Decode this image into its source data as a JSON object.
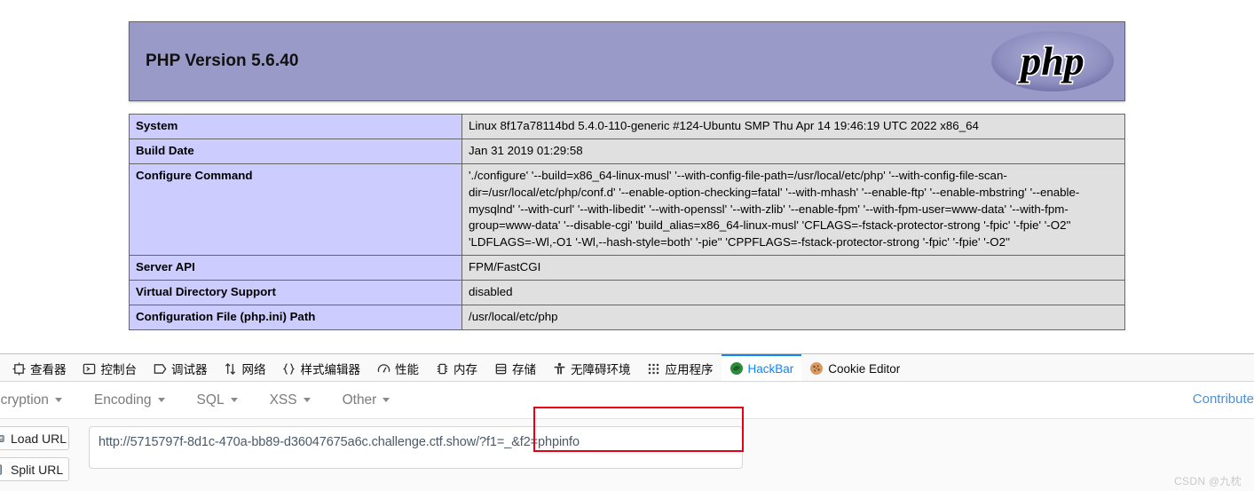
{
  "phpinfo": {
    "version_title": "PHP Version 5.6.40",
    "logo_text": "php",
    "rows": [
      {
        "label": "System",
        "value": "Linux 8f17a78114bd 5.4.0-110-generic #124-Ubuntu SMP Thu Apr 14 19:46:19 UTC 2022 x86_64"
      },
      {
        "label": "Build Date",
        "value": "Jan 31 2019 01:29:58"
      },
      {
        "label": "Configure Command",
        "value": "'./configure'  '--build=x86_64-linux-musl' '--with-config-file-path=/usr/local/etc/php' '--with-config-file-scan-dir=/usr/local/etc/php/conf.d' '--enable-option-checking=fatal' '--with-mhash' '--enable-ftp' '--enable-mbstring' '--enable-mysqlnd' '--with-curl' '--with-libedit' '--with-openssl' '--with-zlib' '--enable-fpm' '--with-fpm-user=www-data' '--with-fpm-group=www-data' '--disable-cgi' 'build_alias=x86_64-linux-musl' 'CFLAGS=-fstack-protector-strong '-fpic' '-fpie' '-O2'' 'LDFLAGS=-Wl,-O1 '-Wl,--hash-style=both' '-pie'' 'CPPFLAGS=-fstack-protector-strong '-fpic' '-fpie' '-O2''"
      },
      {
        "label": "Server API",
        "value": "FPM/FastCGI"
      },
      {
        "label": "Virtual Directory Support",
        "value": "disabled"
      },
      {
        "label": "Configuration File (php.ini) Path",
        "value": "/usr/local/etc/php"
      }
    ]
  },
  "devtools": {
    "tabs": [
      {
        "label": "查看器",
        "icon": "inspector-icon",
        "active": false
      },
      {
        "label": "控制台",
        "icon": "console-icon",
        "active": false
      },
      {
        "label": "调试器",
        "icon": "debugger-icon",
        "active": false
      },
      {
        "label": "网络",
        "icon": "network-icon",
        "active": false
      },
      {
        "label": "样式编辑器",
        "icon": "style-editor-icon",
        "active": false
      },
      {
        "label": "性能",
        "icon": "performance-icon",
        "active": false
      },
      {
        "label": "内存",
        "icon": "memory-icon",
        "active": false
      },
      {
        "label": "存储",
        "icon": "storage-icon",
        "active": false
      },
      {
        "label": "无障碍环境",
        "icon": "accessibility-icon",
        "active": false
      },
      {
        "label": "应用程序",
        "icon": "application-icon",
        "active": false
      },
      {
        "label": "HackBar",
        "icon": "hackbar-icon",
        "active": true
      },
      {
        "label": "Cookie Editor",
        "icon": "cookie-icon",
        "active": false
      }
    ]
  },
  "hackbar": {
    "menus": [
      {
        "label": "ncryption"
      },
      {
        "label": "Encoding"
      },
      {
        "label": "SQL"
      },
      {
        "label": "XSS"
      },
      {
        "label": "Other"
      }
    ],
    "contribute_label": "Contribute",
    "buttons": [
      {
        "label": "Load URL",
        "icon": "load-url-icon"
      },
      {
        "label": "Split URL",
        "icon": "split-url-icon"
      }
    ],
    "url_value": "http://5715797f-8d1c-470a-bb89-d36047675a6c.challenge.ctf.show/?f1=_&f2=phpinfo",
    "url_placeholder": "http://"
  },
  "watermark": {
    "text": "CSDN @九枕"
  },
  "colors": {
    "php_header_bg": "#9a9ac8",
    "table_label_bg": "#ccccff",
    "table_value_bg": "#e0e0e0",
    "active_tab": "#0a84ff",
    "highlight_box": "#e60012",
    "link": "#4a90d9"
  }
}
